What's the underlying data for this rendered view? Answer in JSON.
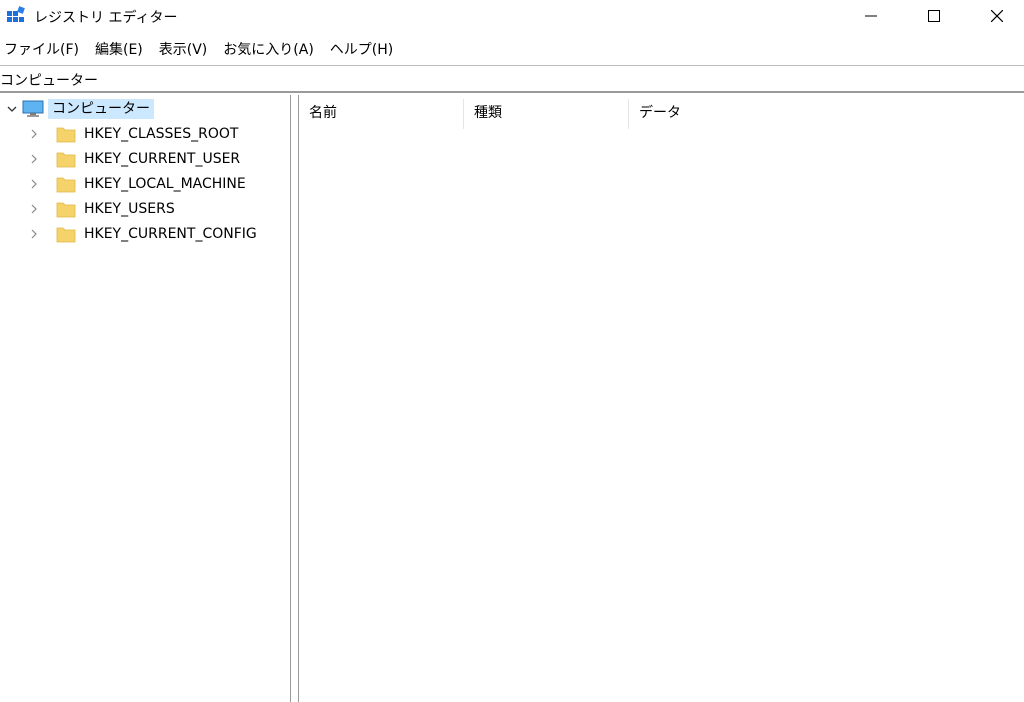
{
  "window": {
    "title": "レジストリ エディター"
  },
  "menu": [
    {
      "label": "ファイル(F)"
    },
    {
      "label": "編集(E)"
    },
    {
      "label": "表示(V)"
    },
    {
      "label": "お気に入り(A)"
    },
    {
      "label": "ヘルプ(H)"
    }
  ],
  "address": {
    "path": "コンピューター"
  },
  "tree": {
    "root": {
      "label": "コンピューター",
      "icon": "computer-icon",
      "expanded": true
    },
    "children": [
      {
        "label": "HKEY_CLASSES_ROOT",
        "icon": "folder-icon"
      },
      {
        "label": "HKEY_CURRENT_USER",
        "icon": "folder-icon"
      },
      {
        "label": "HKEY_LOCAL_MACHINE",
        "icon": "folder-icon"
      },
      {
        "label": "HKEY_USERS",
        "icon": "folder-icon"
      },
      {
        "label": "HKEY_CURRENT_CONFIG",
        "icon": "folder-icon"
      }
    ]
  },
  "list": {
    "columns": [
      {
        "label": "名前"
      },
      {
        "label": "種類"
      },
      {
        "label": "データ"
      }
    ]
  },
  "colors": {
    "selection": "#cce8ff",
    "folder": "#f5d26a",
    "app_icon": "#1e6fd9",
    "divider": "#9a9a9a"
  }
}
